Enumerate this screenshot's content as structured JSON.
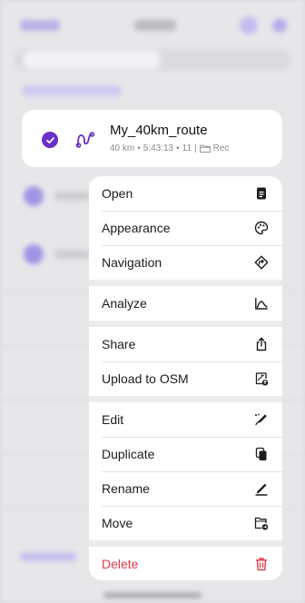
{
  "card": {
    "title": "My_40km_route",
    "distance": "40 km",
    "dot1": "•",
    "duration": "5:43:13",
    "dot2": "•",
    "points": "11",
    "pipe": "|",
    "folder": "Rec"
  },
  "menu": {
    "open": "Open",
    "appearance": "Appearance",
    "navigation": "Navigation",
    "analyze": "Analyze",
    "share": "Share",
    "upload": "Upload to OSM",
    "edit": "Edit",
    "duplicate": "Duplicate",
    "rename": "Rename",
    "move": "Move",
    "delete": "Delete"
  },
  "colors": {
    "accent": "#6a30c9",
    "destructive": "#e5394a"
  }
}
